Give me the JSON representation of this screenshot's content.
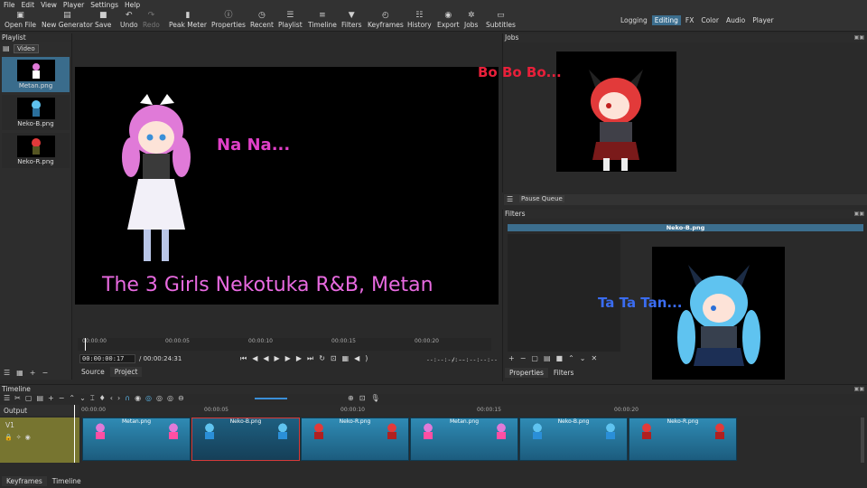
{
  "menu": [
    "File",
    "Edit",
    "View",
    "Player",
    "Settings",
    "Help"
  ],
  "toolbar": [
    {
      "label": "Open File",
      "icon": "folder-icon"
    },
    {
      "label": "New Generator",
      "icon": "generator-icon"
    },
    {
      "label": "Save",
      "icon": "save-icon"
    },
    {
      "label": "Undo",
      "icon": "undo-icon"
    },
    {
      "label": "Redo",
      "icon": "redo-icon"
    },
    {
      "label": "Peak Meter",
      "icon": "meter-icon"
    },
    {
      "label": "Properties",
      "icon": "info-icon"
    },
    {
      "label": "Recent",
      "icon": "clock-icon"
    },
    {
      "label": "Playlist",
      "icon": "list-icon"
    },
    {
      "label": "Timeline",
      "icon": "timeline-icon"
    },
    {
      "label": "Filters",
      "icon": "funnel-icon"
    },
    {
      "label": "Keyframes",
      "icon": "stopwatch-icon"
    },
    {
      "label": "History",
      "icon": "history-icon"
    },
    {
      "label": "Export",
      "icon": "export-icon"
    },
    {
      "label": "Jobs",
      "icon": "gear-icon"
    },
    {
      "label": "Subtitles",
      "icon": "subtitles-icon"
    }
  ],
  "layouts": [
    "Logging",
    "Editing",
    "FX",
    "Color",
    "Audio",
    "Player"
  ],
  "playlist": {
    "title": "Playlist",
    "tab": "Video",
    "items": [
      "Metan.png",
      "Neko-B.png",
      "Neko-R.png"
    ]
  },
  "player": {
    "caption_top": "Na Na...",
    "caption_bottom": "The 3 Girls Nekotuka R&B, Metan",
    "ticks": [
      "00:00:00",
      "00:00:05",
      "00:00:10",
      "00:00:15",
      "00:00:20"
    ],
    "position": "00:00:00:17",
    "duration": "/ 00:00:24:31",
    "in_point": "--:--:--:--",
    "out_point": "/ --:--:--:--",
    "tabs": [
      "Source",
      "Project"
    ]
  },
  "jobs": {
    "title": "Jobs",
    "caption": "Bo Bo Bo...",
    "pause_label": "Pause Queue"
  },
  "filters": {
    "title": "Filters",
    "clip_name": "Neko-B.png",
    "caption": "Ta Ta Tan...",
    "tabs": [
      "Properties",
      "Filters"
    ]
  },
  "timeline": {
    "title": "Timeline",
    "output_label": "Output",
    "track": "V1",
    "ticks": [
      "00:00:00",
      "00:00:05",
      "00:00:10",
      "00:00:15",
      "00:00:20"
    ],
    "clips": [
      {
        "name": "Metan.png",
        "colors": [
          "#e07ad8",
          "#ff4fa3"
        ]
      },
      {
        "name": "Neko-B.png",
        "colors": [
          "#5fc3f0",
          "#2a8fd8"
        ]
      },
      {
        "name": "Neko-R.png",
        "colors": [
          "#e23a3a",
          "#b02020"
        ]
      },
      {
        "name": "Metan.png",
        "colors": [
          "#e07ad8",
          "#ff4fa3"
        ]
      },
      {
        "name": "Neko-B.png",
        "colors": [
          "#5fc3f0",
          "#2a8fd8"
        ]
      },
      {
        "name": "Neko-R.png",
        "colors": [
          "#e23a3a",
          "#b02020"
        ]
      }
    ],
    "tabs": [
      "Keyframes",
      "Timeline"
    ]
  },
  "colors": {
    "accent": "#3c6e8e",
    "clip": "#2f8bb4",
    "metan": "#d94fd0",
    "red": "#e8203a",
    "blue": "#3a6cf0"
  }
}
